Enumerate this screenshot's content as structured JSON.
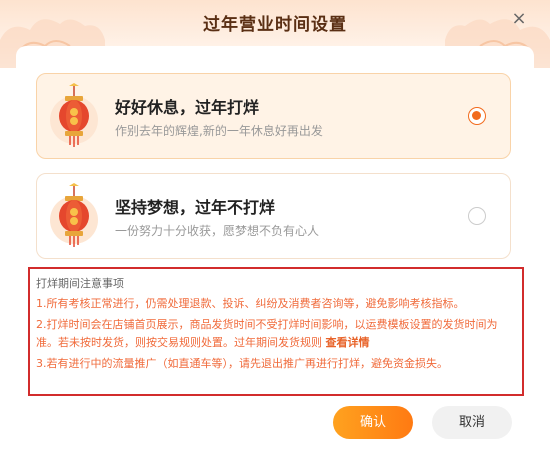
{
  "dialog": {
    "title": "过年营业时间设置",
    "close_label": "×"
  },
  "options": [
    {
      "title": "好好休息，过年打烊",
      "subtitle": "作别去年的辉煌,新的一年休息好再出发",
      "selected": true
    },
    {
      "title": "坚持梦想，过年不打烊",
      "subtitle": "一份努力十分收获，愿梦想不负有心人",
      "selected": false
    }
  ],
  "notice": {
    "title": "打烊期间注意事项",
    "item1": "1.所有考核正常进行，仍需处理退款、投诉、纠纷及消费者咨询等，避免影响考核指标。",
    "item2": "2.打烊时间会在店铺首页展示，商品发货时间不受打烊时间影响，以运费模板设置的发货时间为准。若未按时发货，则按交易规则处置。过年期间发货规则",
    "item2_link": "查看详情",
    "item3": "3.若有进行中的流量推广（如直通车等），请先退出推广再进行打烊，避免资金损失。"
  },
  "buttons": {
    "confirm": "确认",
    "cancel": "取消"
  },
  "colors": {
    "accent": "#f26b1d",
    "notice_text": "#f06a3a",
    "highlight_border": "#d22c2c"
  }
}
